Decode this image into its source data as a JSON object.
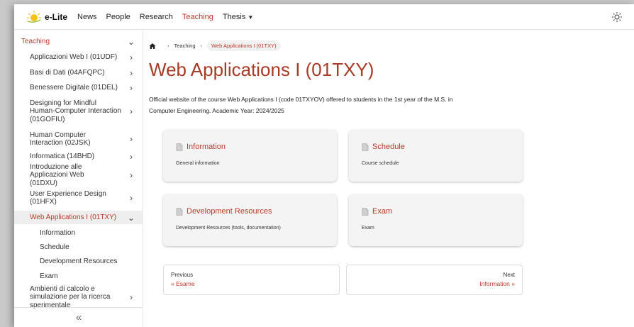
{
  "header": {
    "logo_text": "e-Lite",
    "nav": [
      {
        "label": "News",
        "active": false
      },
      {
        "label": "People",
        "active": false
      },
      {
        "label": "Research",
        "active": false
      },
      {
        "label": "Teaching",
        "active": true
      },
      {
        "label": "Thesis",
        "active": false,
        "has_dropdown": true
      }
    ],
    "theme_icon": "sun-icon"
  },
  "sidebar": {
    "heading": "Teaching",
    "courses": [
      {
        "label": "Applicazioni Web I (01UDF)"
      },
      {
        "label": "Basi di Dati (04AFQPC)"
      },
      {
        "label": "Benessere Digitale (01DEL)"
      },
      {
        "label": "Designing for Mindful Human-Computer Interaction (01GOFIU)"
      },
      {
        "label": "Human Computer Interaction (02JSK)"
      },
      {
        "label": "Informatica (14BHD)"
      },
      {
        "label": "Introduzione alle Applicazioni Web (01DXU)"
      },
      {
        "label": "User Experience Design (01HFX)"
      },
      {
        "label": "Web Applications I (01TXY)",
        "selected": true
      },
      {
        "label": "Ambienti di calcolo e simulazione per la ricerca sperimentale"
      }
    ],
    "subitems": [
      "Information",
      "Schedule",
      "Development Resources",
      "Exam"
    ],
    "collapse_label": "«"
  },
  "breadcrumb": {
    "items": [
      "Teaching"
    ],
    "current": "Web Applications I (01TXY)"
  },
  "page": {
    "title": "Web Applications I (01TXY)",
    "intro_line1": "Official website of the course Web Applications I (code 01TXYOV) offered to students in the 1st year of the M.S. in",
    "intro_line2": "Computer Engineering. Academic Year: 2024/2025"
  },
  "cards": [
    {
      "title": "Information",
      "desc": "General information"
    },
    {
      "title": "Schedule",
      "desc": "Course schedule"
    },
    {
      "title": "Development Resources",
      "desc": "Development Resources (tools, documentation)"
    },
    {
      "title": "Exam",
      "desc": "Exam"
    }
  ],
  "pager": {
    "prev_label": "Previous",
    "prev_link": "« Esame",
    "next_label": "Next",
    "next_link": "Information »"
  },
  "colors": {
    "accent": "#b9392a",
    "title": "#a83a26"
  }
}
